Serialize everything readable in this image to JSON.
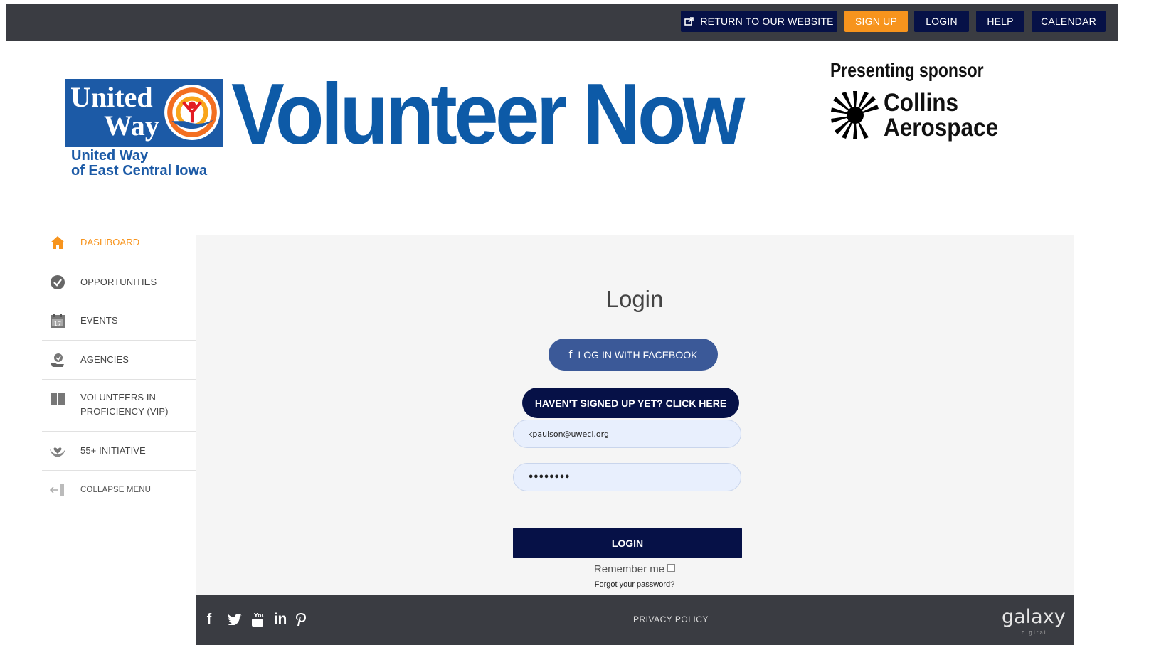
{
  "topbar": {
    "return_label": "RETURN TO OUR WEBSITE",
    "signup_label": "SIGN UP",
    "login_label": "LOGIN",
    "help_label": "HELP",
    "calendar_label": "CALENDAR"
  },
  "header": {
    "uw_line1": "United",
    "uw_line2": "Way",
    "uw_org_line1": "United Way",
    "uw_org_line2": "of East Central Iowa",
    "title": "Volunteer Now",
    "sponsor_label": "Presenting sponsor",
    "sponsor_line1": "Collins",
    "sponsor_line2": "Aerospace"
  },
  "sidebar": {
    "items": [
      {
        "label": "DASHBOARD",
        "icon": "home-icon"
      },
      {
        "label": "OPPORTUNITIES",
        "icon": "check-circle-icon"
      },
      {
        "label": "EVENTS",
        "icon": "calendar-icon"
      },
      {
        "label": "AGENCIES",
        "icon": "hand-heart-icon"
      },
      {
        "label": "VOLUNTEERS IN",
        "label2": "PROFICIENCY (VIP)",
        "icon": "book-icon"
      },
      {
        "label": "55+ INITIATIVE",
        "icon": "hands-heart-icon"
      },
      {
        "label": "COLLAPSE MENU",
        "icon": "collapse-arrow-icon"
      }
    ]
  },
  "login": {
    "title": "Login",
    "facebook_label": "LOG IN WITH FACEBOOK",
    "signup_prompt": "HAVEN'T SIGNED UP YET? CLICK HERE",
    "email_value": "kpaulson@uweci.org",
    "password_value": "••••••••",
    "login_label": "LOGIN",
    "remember_label": "Remember me",
    "forgot_label": "Forgot your password?"
  },
  "footer": {
    "privacy_label": "PRIVACY POLICY",
    "brand": "galaxy",
    "brand_sub": "digital",
    "social": [
      "facebook-icon",
      "twitter-icon",
      "youtube-icon",
      "linkedin-icon",
      "pinterest-icon"
    ]
  },
  "colors": {
    "navy": "#061147",
    "orange": "#f7941d",
    "topbar": "#3a3c42",
    "uw_blue": "#1c5aa6",
    "facebook": "#3b5998"
  }
}
